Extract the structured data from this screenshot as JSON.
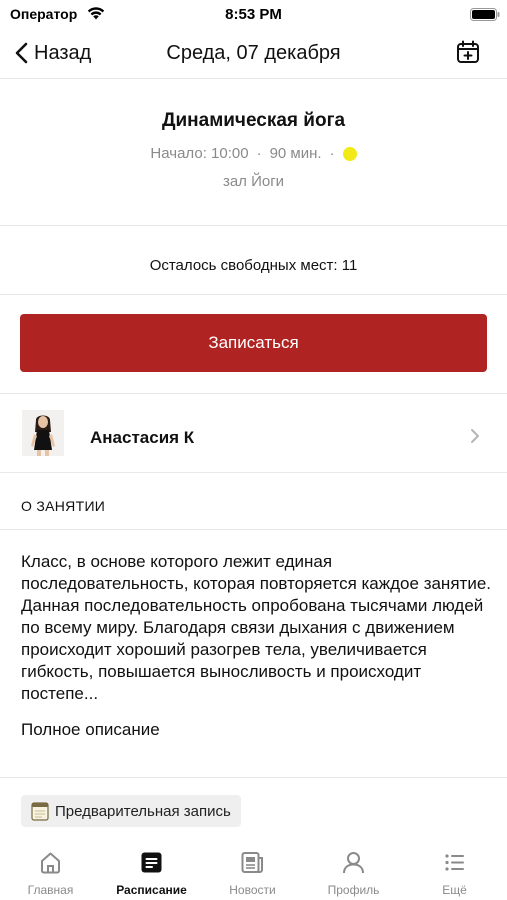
{
  "status_bar": {
    "carrier": "Оператор",
    "time": "8:53 PM"
  },
  "nav": {
    "back_label": "Назад",
    "title": "Среда, 07 декабря"
  },
  "class_info": {
    "title": "Динамическая йога",
    "start": "Начало: 10:00",
    "duration": "90 мин.",
    "status_color": "#f2ea17",
    "room": "зал Йоги"
  },
  "seats_text": "Осталось свободных мест: 11",
  "signup": {
    "label": "Записаться",
    "color": "#b02323"
  },
  "trainer": {
    "name": "Анастасия К"
  },
  "about": {
    "heading": "О ЗАНЯТИИ",
    "text": "Класс, в основе которого лежит единая последовательность, которая повторяется каждое занятие. Данная последовательность опробована тысячами людей по всему миру. Благодаря связи дыхания с движением происходит хороший разогрев тела, увеличивается гибкость, повышается выносливость и происходит постепе...",
    "full_link": "Полное описание"
  },
  "chip": {
    "icon": "notepad-icon",
    "label": "Предварительная запись"
  },
  "tabs": [
    {
      "label": "Главная",
      "icon": "home-icon",
      "active": false
    },
    {
      "label": "Расписание",
      "icon": "schedule-icon",
      "active": true
    },
    {
      "label": "Новости",
      "icon": "news-icon",
      "active": false
    },
    {
      "label": "Профиль",
      "icon": "profile-icon",
      "active": false
    },
    {
      "label": "Ещё",
      "icon": "more-icon",
      "active": false
    }
  ]
}
